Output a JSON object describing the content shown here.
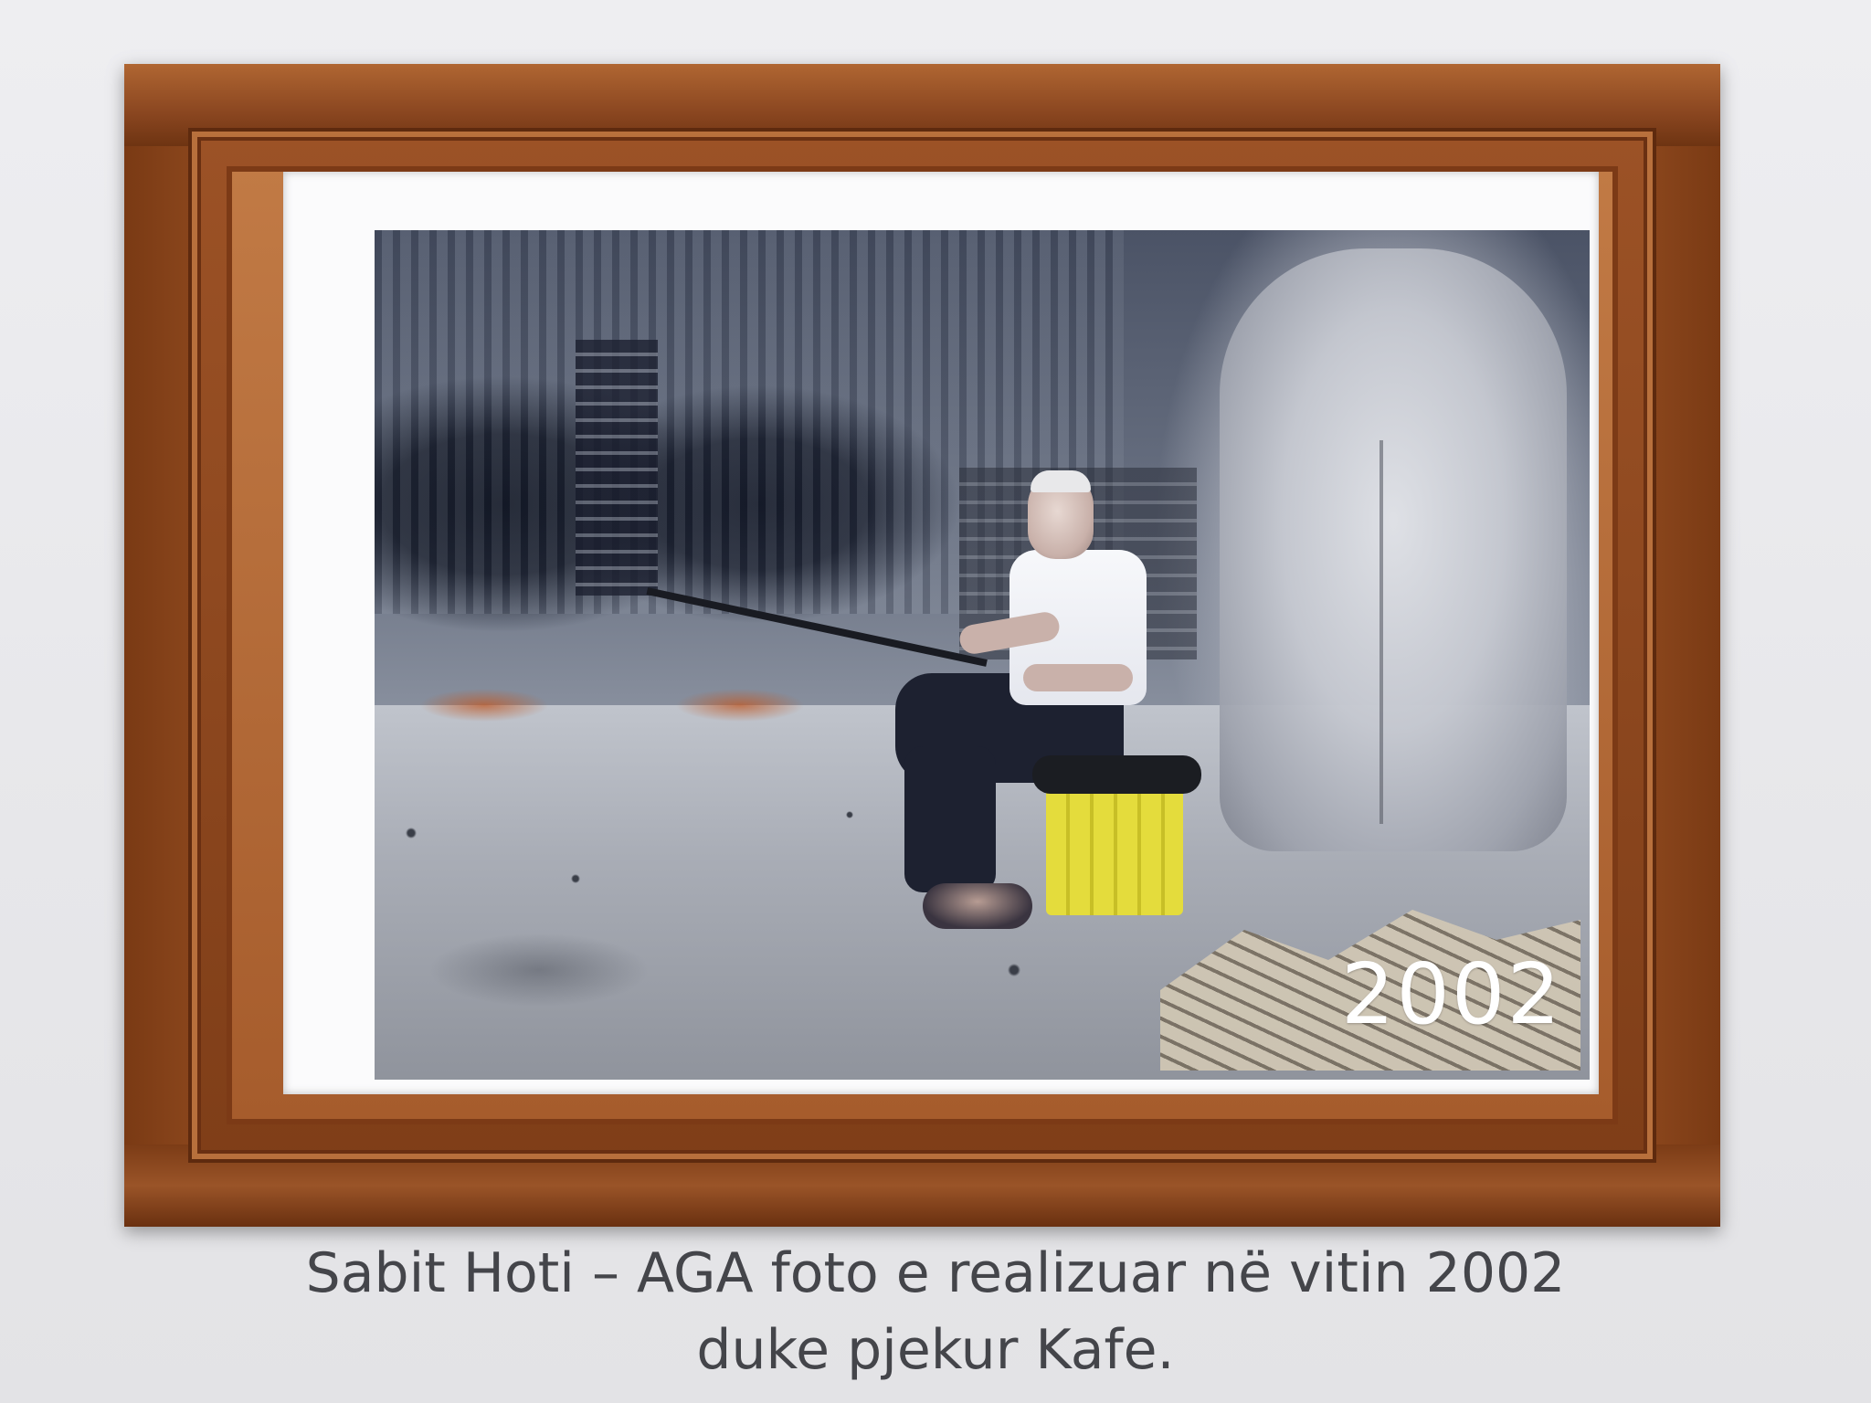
{
  "photo": {
    "year_stamp": "2002"
  },
  "caption": {
    "line1": "Sabit Hoti – AGA foto e realizuar në vitin 2002",
    "line2": "duke pjekur Kafe."
  },
  "colors": {
    "wall": "#e9e9ec",
    "frame_wood": "#8d4820",
    "mat": "#fbfbfc",
    "caption_text": "#44454a",
    "stamp_text": "#ffffff"
  }
}
